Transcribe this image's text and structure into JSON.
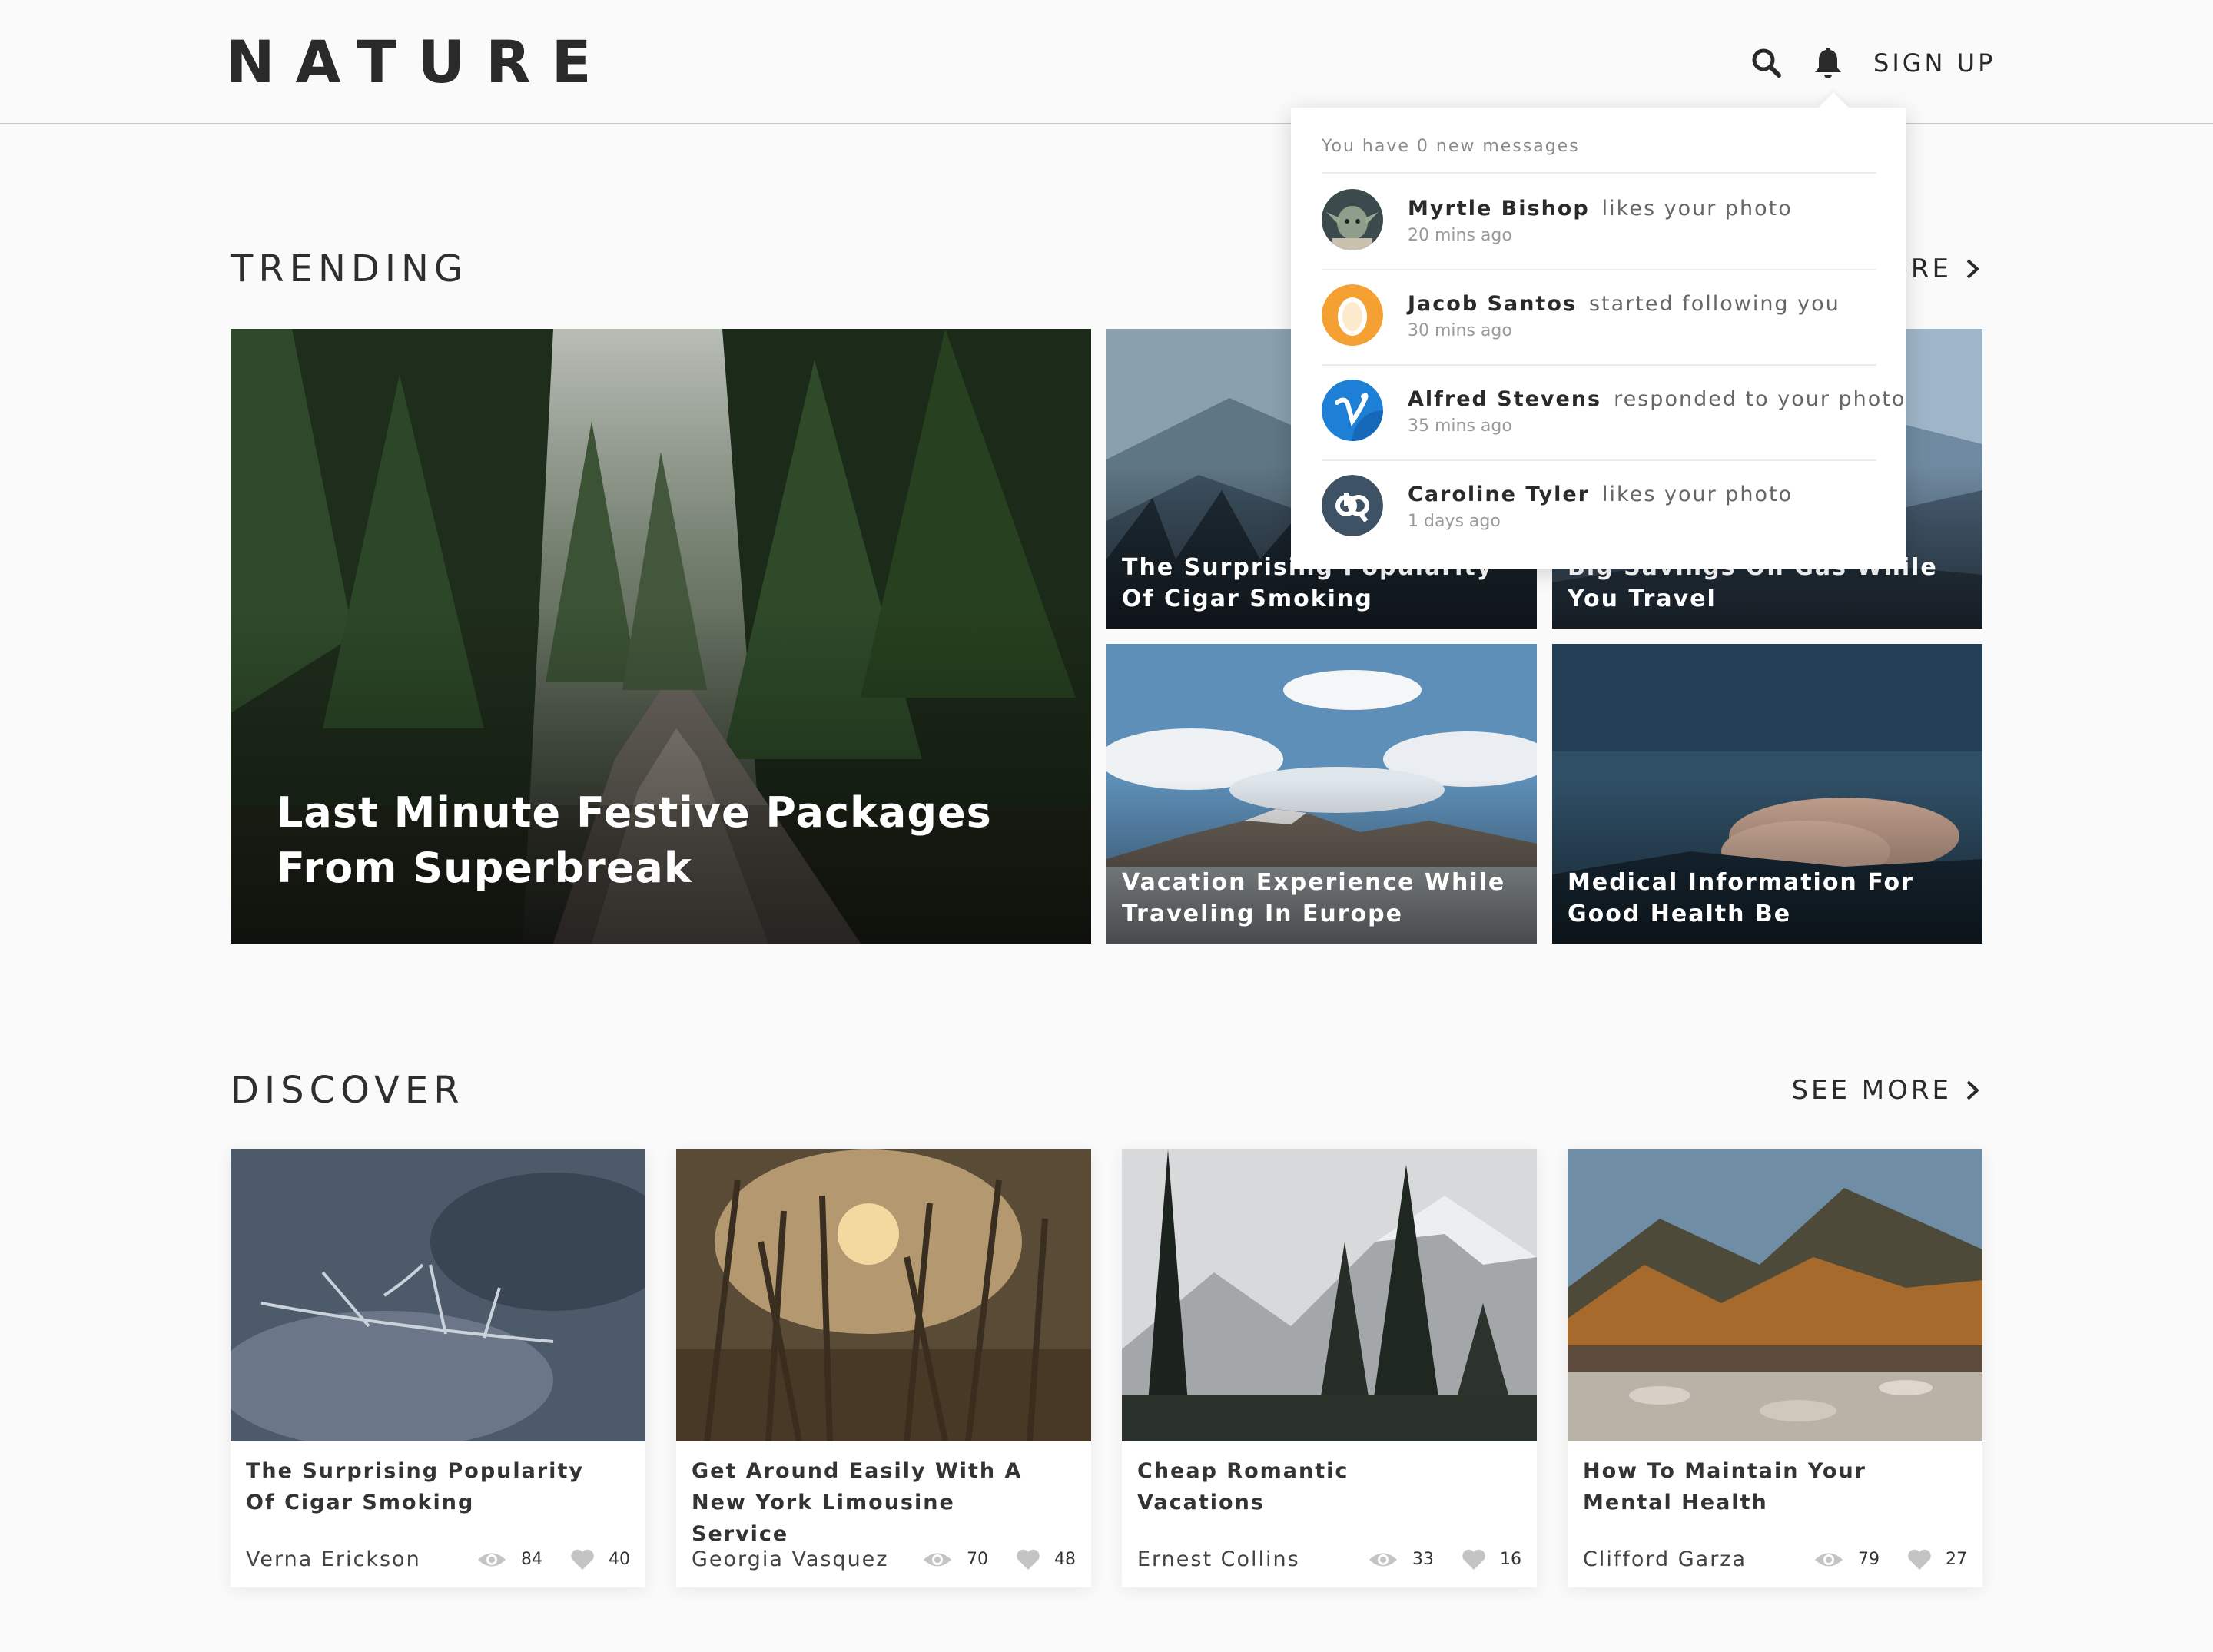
{
  "header": {
    "logo": "NATURE",
    "sign_up": "SIGN UP",
    "icons": [
      "search-icon",
      "bell-icon"
    ]
  },
  "trending": {
    "title": "TRENDING",
    "see_more": "SEE MORE",
    "tiles": [
      {
        "title": "Last Minute Festive Packages From Superbreak"
      },
      {
        "title": "The Surprising Popularity Of Cigar Smoking"
      },
      {
        "title": "Big Savings On Gas While You Travel"
      },
      {
        "title": "Vacation Experience While Traveling In Europe"
      },
      {
        "title": "Medical Information For Good Health Be"
      }
    ]
  },
  "discover": {
    "title": "DISCOVER",
    "see_more": "SEE MORE",
    "cards": [
      {
        "title": "The Surprising Popularity Of Cigar Smoking",
        "author": "Verna Erickson",
        "views": "84",
        "likes": "40"
      },
      {
        "title": "Get Around Easily With A New York Limousine Service",
        "author": "Georgia Vasquez",
        "views": "70",
        "likes": "48"
      },
      {
        "title": "Cheap Romantic Vacations",
        "author": "Ernest Collins",
        "views": "33",
        "likes": "16"
      },
      {
        "title": "How To Maintain Your Mental Health",
        "author": "Clifford Garza",
        "views": "79",
        "likes": "27"
      }
    ]
  },
  "notifications": {
    "header": "You have 0 new messages",
    "items": [
      {
        "name": "Myrtle Bishop",
        "action": "likes your photo",
        "time": "20 mins ago"
      },
      {
        "name": "Jacob Santos",
        "action": "started following you",
        "time": "30 mins ago"
      },
      {
        "name": "Alfred Stevens",
        "action": "responded to your photo",
        "time": "35 mins ago"
      },
      {
        "name": "Caroline Tyler",
        "action": "likes your photo",
        "time": "1 days ago"
      }
    ]
  },
  "colors": {
    "background": "#fafafa",
    "text": "#2a2a2a",
    "orange_avatar": "#f5a033",
    "blue_avatar": "#1d7fd6"
  }
}
